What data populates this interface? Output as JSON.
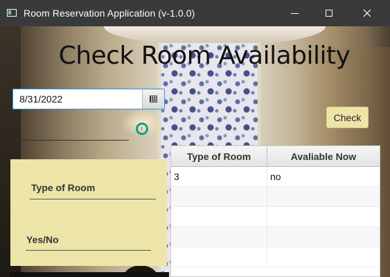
{
  "window": {
    "title": "Room Reservation Application (v-1.0.0)",
    "icons": {
      "app": "app-window-icon",
      "minimize": "minimize-icon",
      "maximize": "maximize-icon",
      "close": "close-icon"
    }
  },
  "header": {
    "title": "Check Room Availability"
  },
  "date_picker": {
    "value": "8/31/2022",
    "button_icon": "calendar-icon"
  },
  "check_button": {
    "label": "Check",
    "color": "#eee4a8"
  },
  "form": {
    "type_label": "Type of Room",
    "availability_label": "Yes/No",
    "panel_color": "#ede5a8"
  },
  "table": {
    "columns": [
      "Type of Room",
      "Avaliable Now"
    ],
    "rows": [
      [
        "3",
        "no"
      ],
      [
        "",
        ""
      ],
      [
        "",
        ""
      ],
      [
        "",
        ""
      ],
      [
        "",
        ""
      ]
    ]
  },
  "colors": {
    "titlebar": "#3a3a3a",
    "focus_border": "#2b95d4",
    "spinner": "#10a08a"
  }
}
